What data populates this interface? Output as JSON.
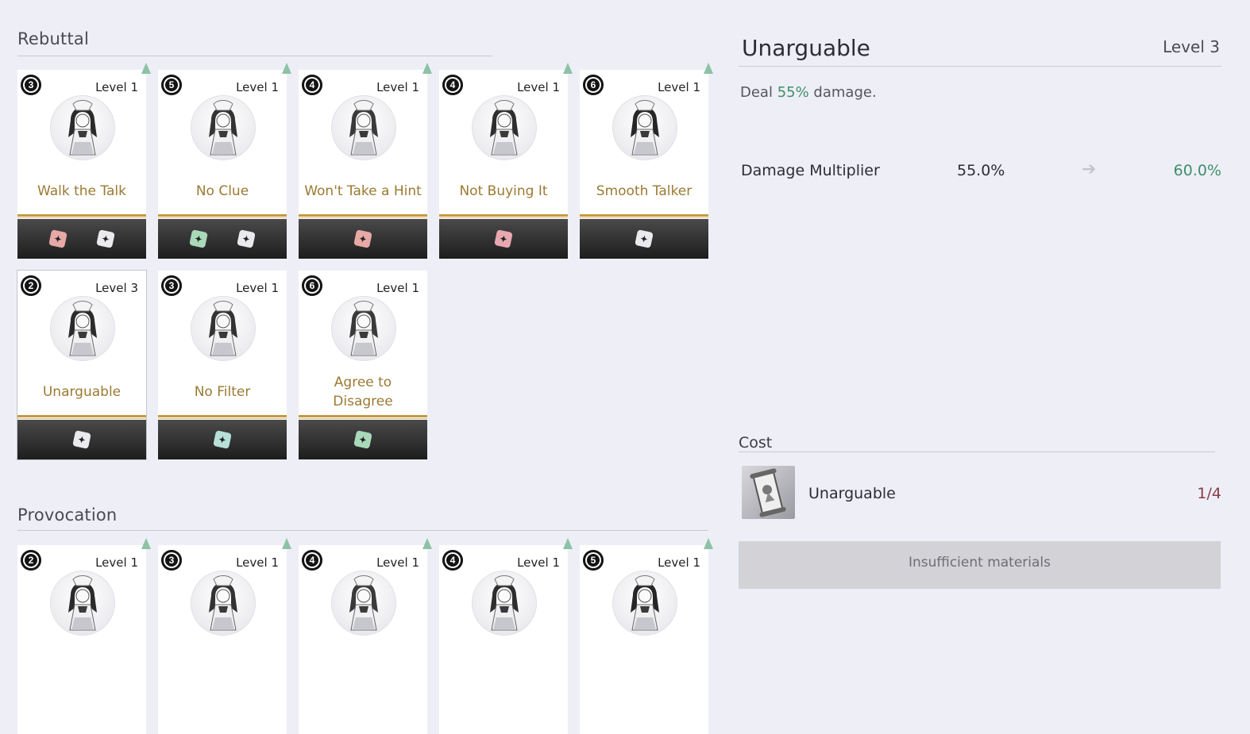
{
  "rebuttal": {
    "title": "Rebuttal",
    "cards": [
      {
        "cost": "3",
        "level": "Level 1",
        "name": "Walk the Talk",
        "upgradable": true,
        "tags": [
          "red",
          "white"
        ]
      },
      {
        "cost": "5",
        "level": "Level 1",
        "name": "No Clue",
        "upgradable": true,
        "tags": [
          "green",
          "white"
        ]
      },
      {
        "cost": "4",
        "level": "Level 1",
        "name": "Won't Take a Hint",
        "upgradable": true,
        "tags": [
          "red"
        ]
      },
      {
        "cost": "4",
        "level": "Level 1",
        "name": "Not Buying It",
        "upgradable": true,
        "tags": [
          "pink"
        ]
      },
      {
        "cost": "6",
        "level": "Level 1",
        "name": "Smooth Talker",
        "upgradable": true,
        "tags": [
          "white"
        ]
      },
      {
        "cost": "2",
        "level": "Level 3",
        "name": "Unarguable",
        "upgradable": false,
        "selected": true,
        "tags": [
          "white"
        ]
      },
      {
        "cost": "3",
        "level": "Level 1",
        "name": "No Filter",
        "upgradable": false,
        "tags": [
          "teal"
        ]
      },
      {
        "cost": "6",
        "level": "Level 1",
        "name": "Agree to Disagree",
        "upgradable": false,
        "tags": [
          "green"
        ]
      }
    ]
  },
  "provocation": {
    "title": "Provocation",
    "cards": [
      {
        "cost": "2",
        "level": "Level 1",
        "upgradable": true
      },
      {
        "cost": "3",
        "level": "Level 1",
        "upgradable": true
      },
      {
        "cost": "4",
        "level": "Level 1",
        "upgradable": true
      },
      {
        "cost": "4",
        "level": "Level 1",
        "upgradable": true
      },
      {
        "cost": "5",
        "level": "Level 1",
        "upgradable": true
      }
    ]
  },
  "detail": {
    "title": "Unarguable",
    "level": "Level 3",
    "desc_prefix": "Deal ",
    "desc_value": "55%",
    "desc_suffix": " damage.",
    "stat_label": "Damage Multiplier",
    "stat_from": "55.0%",
    "stat_to": "60.0%",
    "cost_title": "Cost",
    "material_name": "Unarguable",
    "material_count": "1/4",
    "button_label": "Insufficient materials"
  },
  "colors": {
    "accent_green": "#3f8f6b",
    "gold": "#c59a3f",
    "card_name": "#9b7a33"
  }
}
